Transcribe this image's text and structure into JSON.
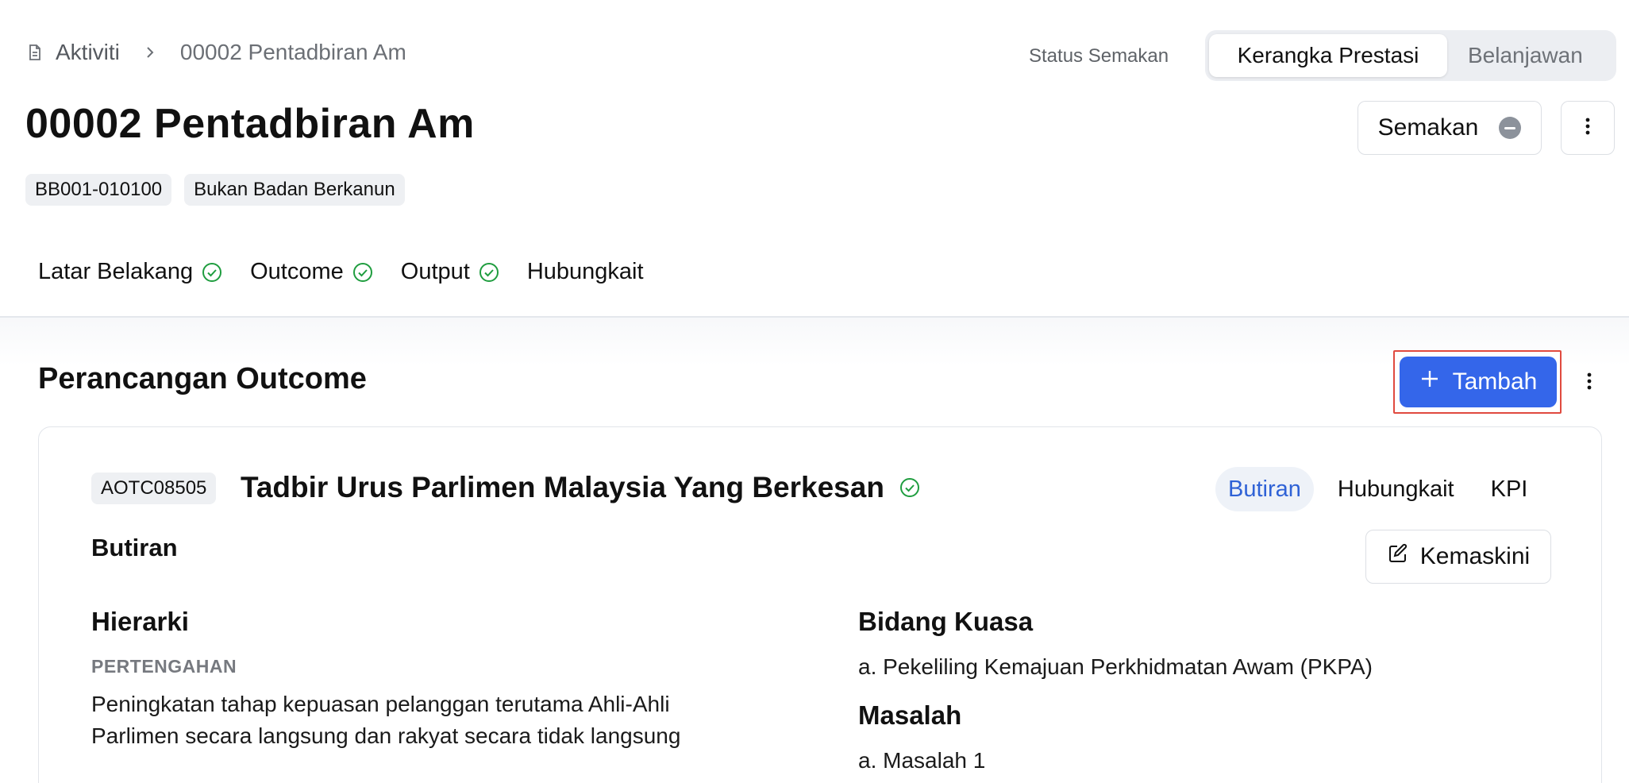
{
  "breadcrumb": {
    "icon": "document-icon",
    "root": "Aktiviti",
    "separator_icon": "chevron-right-icon",
    "current": "00002 Pentadbiran Am"
  },
  "header": {
    "status_label": "Status Semakan",
    "segments": [
      "Kerangka Prestasi",
      "Belanjawan"
    ],
    "active_segment": "Kerangka Prestasi",
    "title": "00002 Pentadbiran Am",
    "semakan_button": "Semakan",
    "tags": [
      "BB001-010100",
      "Bukan Badan Berkanun"
    ]
  },
  "tabs": [
    {
      "label": "Latar Belakang",
      "complete": true
    },
    {
      "label": "Outcome",
      "complete": true
    },
    {
      "label": "Output",
      "complete": true
    },
    {
      "label": "Hubungkait",
      "complete": false
    }
  ],
  "section": {
    "title": "Perancangan Outcome",
    "add_button": "Tambah"
  },
  "card": {
    "code": "AOTC08505",
    "title": "Tadbir Urus Parlimen Malaysia Yang Berkesan",
    "tabs": [
      "Butiran",
      "Hubungkait",
      "KPI"
    ],
    "active_tab": "Butiran",
    "heading": "Butiran",
    "edit_button": "Kemaskini",
    "hierarki": {
      "label": "Hierarki",
      "level": "PERTENGAHAN",
      "text_line1": "Peningkatan tahap kepuasan pelanggan terutama Ahli-Ahli",
      "text_line2": "Parlimen secara langsung dan rakyat secara tidak langsung"
    },
    "bidang_kuasa": {
      "label": "Bidang Kuasa",
      "items": [
        "a. Pekeliling Kemajuan Perkhidmatan Awam (PKPA)"
      ]
    },
    "masalah": {
      "label": "Masalah",
      "items": [
        "a. Masalah 1"
      ]
    }
  },
  "colors": {
    "primary": "#3466ea",
    "success": "#1f9d3f",
    "highlight_border": "#e04a3f",
    "muted": "#6b6f75"
  }
}
